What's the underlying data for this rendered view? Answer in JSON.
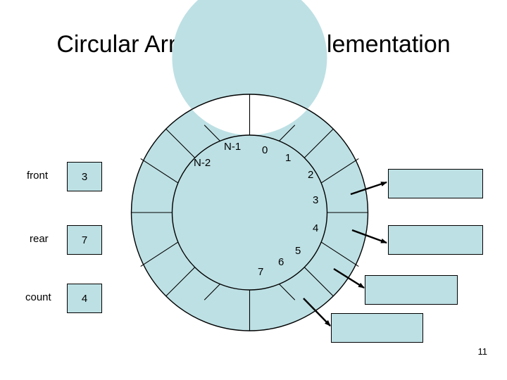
{
  "slide": {
    "title": "Circular Array Queue Implementation",
    "page_number": "11",
    "colors": {
      "fill": "#bde0e4",
      "stroke": "#000000",
      "background": "#ffffff",
      "text": "#000000"
    }
  },
  "variables": [
    {
      "label": "front",
      "value": "3"
    },
    {
      "label": "rear",
      "value": "7"
    },
    {
      "label": "count",
      "value": "4"
    }
  ],
  "ring": {
    "segment_count": 16,
    "index_labels": [
      "N-2",
      "N-1",
      "0",
      "1",
      "2",
      "3",
      "4",
      "5",
      "6",
      "7"
    ]
  },
  "callouts": [
    {
      "text": ""
    },
    {
      "text": ""
    },
    {
      "text": ""
    },
    {
      "text": ""
    }
  ]
}
